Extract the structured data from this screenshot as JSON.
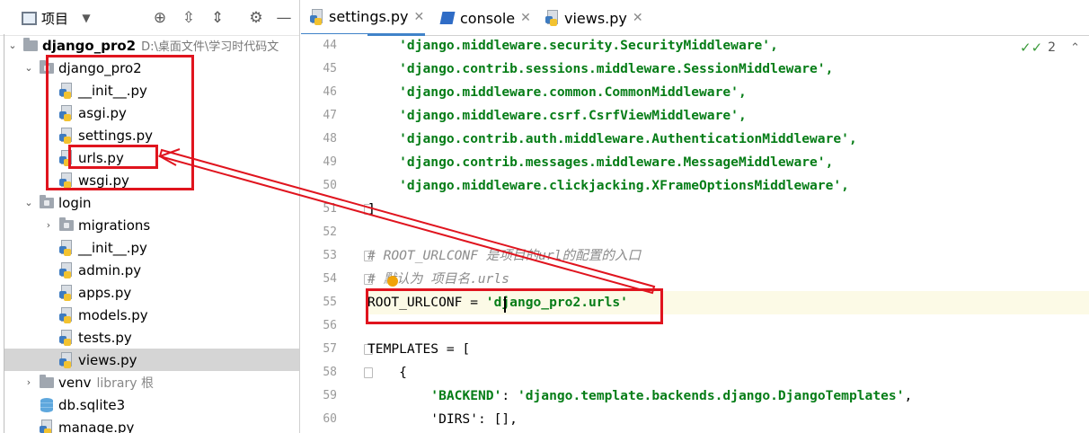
{
  "project_panel": {
    "title": "项目",
    "tree": [
      {
        "name": "django_pro2",
        "path": "D:\\桌面文件\\学习时代码文",
        "kind": "folder",
        "expanded": true,
        "bold": true
      },
      {
        "name": "django_pro2",
        "kind": "package",
        "expanded": true
      },
      {
        "name": "__init__.py",
        "kind": "py"
      },
      {
        "name": "asgi.py",
        "kind": "py"
      },
      {
        "name": "settings.py",
        "kind": "py"
      },
      {
        "name": "urls.py",
        "kind": "py"
      },
      {
        "name": "wsgi.py",
        "kind": "py"
      },
      {
        "name": "login",
        "kind": "package",
        "expanded": true
      },
      {
        "name": "migrations",
        "kind": "package",
        "expanded": false
      },
      {
        "name": "__init__.py",
        "kind": "py"
      },
      {
        "name": "admin.py",
        "kind": "py"
      },
      {
        "name": "apps.py",
        "kind": "py"
      },
      {
        "name": "models.py",
        "kind": "py"
      },
      {
        "name": "tests.py",
        "kind": "py"
      },
      {
        "name": "views.py",
        "kind": "py",
        "selected": true
      },
      {
        "name": "venv",
        "hint": "library 根",
        "kind": "folder",
        "expanded": false
      },
      {
        "name": "db.sqlite3",
        "kind": "db"
      },
      {
        "name": "manage.py",
        "kind": "py"
      }
    ]
  },
  "editor": {
    "tabs": [
      {
        "label": "settings.py",
        "active": true
      },
      {
        "label": "console",
        "active": false
      },
      {
        "label": "views.py",
        "active": false
      }
    ],
    "inspection_count": "2",
    "lines": [
      {
        "num": "44",
        "text": "    'django.middleware.security.SecurityMiddleware',"
      },
      {
        "num": "45",
        "text": "    'django.contrib.sessions.middleware.SessionMiddleware',"
      },
      {
        "num": "46",
        "text": "    'django.middleware.common.CommonMiddleware',"
      },
      {
        "num": "47",
        "text": "    'django.middleware.csrf.CsrfViewMiddleware',"
      },
      {
        "num": "48",
        "text": "    'django.contrib.auth.middleware.AuthenticationMiddleware',"
      },
      {
        "num": "49",
        "text": "    'django.contrib.messages.middleware.MessageMiddleware',"
      },
      {
        "num": "50",
        "text": "    'django.middleware.clickjacking.XFrameOptionsMiddleware',"
      },
      {
        "num": "51",
        "text": "]"
      },
      {
        "num": "52",
        "text": ""
      },
      {
        "num": "53",
        "text": "# ROOT_URLCONF 是项目的url的配置的入口"
      },
      {
        "num": "54",
        "text": "# 默认为 项目名.urls"
      },
      {
        "num": "55",
        "text": "ROOT_URLCONF = 'django_pro2.urls'"
      },
      {
        "num": "56",
        "text": ""
      },
      {
        "num": "57",
        "text": "TEMPLATES = ["
      },
      {
        "num": "58",
        "text": "    {"
      },
      {
        "num": "59",
        "text": "        'BACKEND': 'django.template.backends.django.DjangoTemplates',"
      },
      {
        "num": "60",
        "text": "        'DIRS': [],"
      }
    ]
  },
  "colors": {
    "annotation_red": "#e0141e",
    "string_green": "#067d17",
    "comment_gray": "#8c8c8c",
    "active_tab_blue": "#4083c9"
  }
}
